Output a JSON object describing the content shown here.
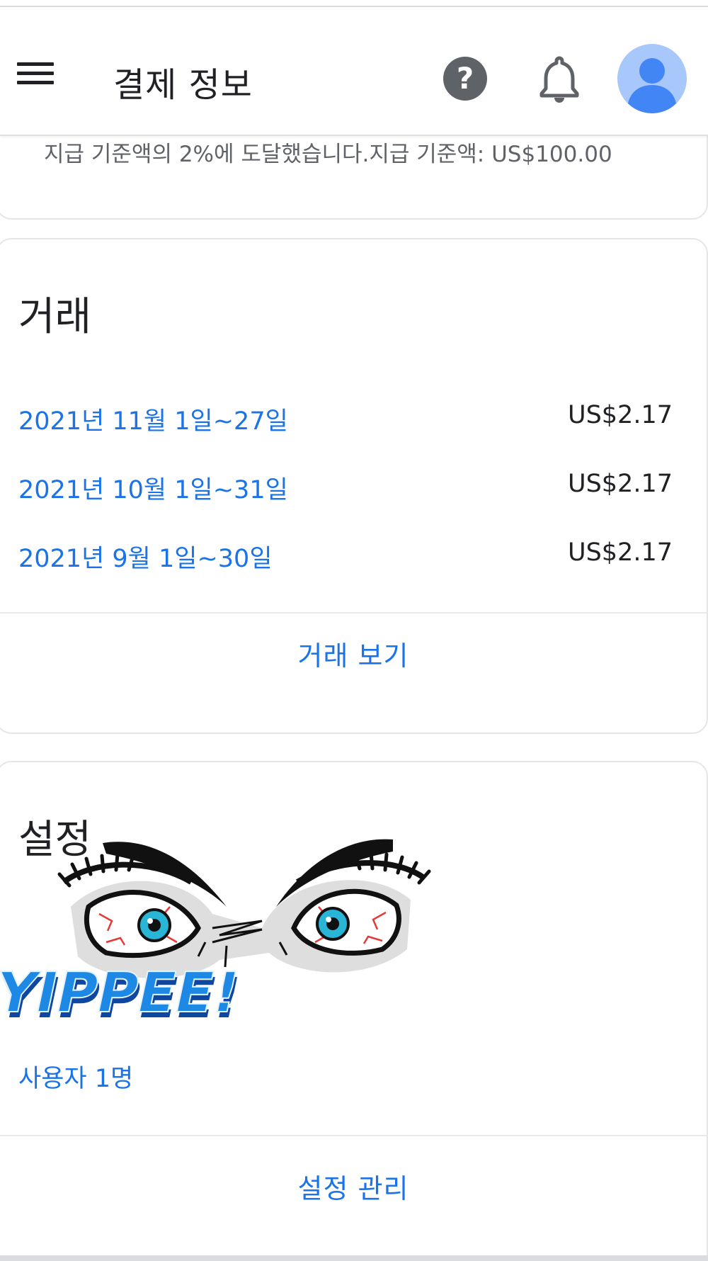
{
  "app_bar": {
    "title": "결제 정보",
    "menu_icon": "hamburger-menu-icon",
    "help_icon": "help-circle-icon",
    "help_glyph": "?",
    "notifications_icon": "bell-icon",
    "avatar_icon": "account-avatar-icon"
  },
  "payment_threshold": {
    "text": "지급 기준액의 2%에 도달했습니다.지급 기준액: US$100.00"
  },
  "transactions": {
    "title": "거래",
    "rows": [
      {
        "period": "2021년 11월 1일~27일",
        "amount": "US$2.17"
      },
      {
        "period": "2021년 10월 1일~31일",
        "amount": "US$2.17"
      },
      {
        "period": "2021년 9월 1일~30일",
        "amount": "US$2.17"
      }
    ],
    "view_button": "거래 보기"
  },
  "settings": {
    "title": "설정",
    "users_link": "사용자 1명",
    "manage_button": "설정 관리"
  },
  "overlay": {
    "sticker_icon": "angry-eyes-sticker",
    "sticker_text": "YIPPEE!"
  },
  "colors": {
    "accent": "#1a73e8",
    "text_primary": "#202124",
    "text_secondary": "#5f6368",
    "avatar_bg": "#a8c7fa",
    "avatar_fg": "#4285f4"
  }
}
